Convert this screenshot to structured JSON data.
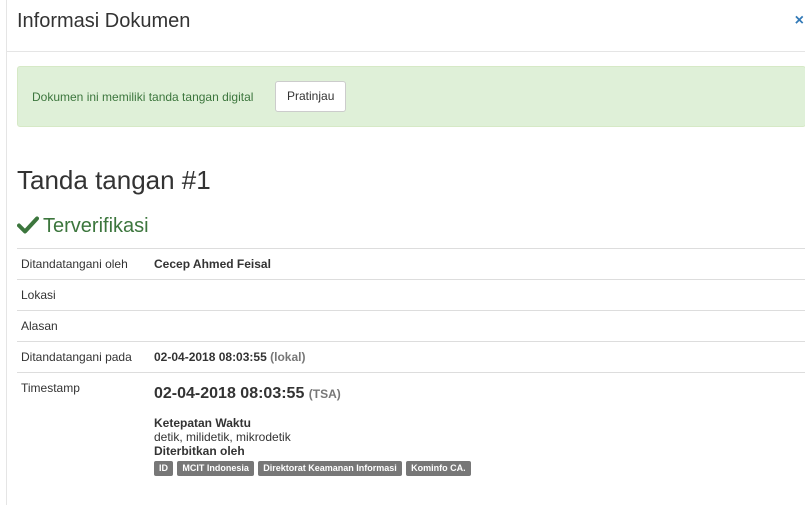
{
  "header": {
    "title": "Informasi Dokumen",
    "close_label": "×"
  },
  "alert": {
    "message": "Dokumen ini memiliki tanda tangan digital",
    "preview_label": "Pratinjau"
  },
  "signature": {
    "title": "Tanda tangan #1",
    "status": "Terverifikasi",
    "rows": {
      "signed_by_label": "Ditandatangani oleh",
      "signed_by_value": "Cecep Ahmed Feisal",
      "location_label": "Lokasi",
      "location_value": "",
      "reason_label": "Alasan",
      "reason_value": "",
      "signed_at_label": "Ditandatangani pada",
      "signed_at_value": "02-04-2018 08:03:55",
      "signed_at_suffix": "(lokal)",
      "timestamp_label": "Timestamp"
    },
    "timestamp": {
      "value": "02-04-2018 08:03:55",
      "suffix": "(TSA)",
      "accuracy_heading": "Ketepatan Waktu",
      "accuracy_value": "detik, milidetik, mikrodetik",
      "issuer_heading": "Diterbitkan oleh",
      "issuer_labels": [
        "ID",
        "MCIT Indonesia",
        "Direktorat Keamanan Informasi",
        "Kominfo CA."
      ]
    }
  },
  "colors": {
    "success": "#3c763d",
    "alert_bg": "#dff0d8",
    "link": "#337ab7",
    "badge": "#777777"
  }
}
